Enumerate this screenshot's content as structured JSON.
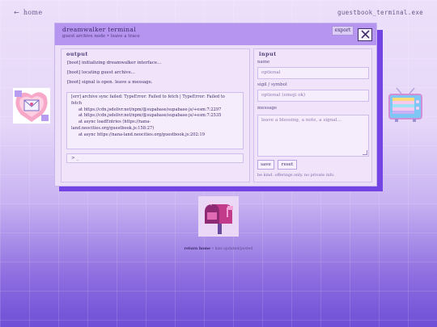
{
  "nav": {
    "home_arrow": "←",
    "home_label": "home",
    "site_name": "guestbook_terminal.exe"
  },
  "window": {
    "title": "dreamwalker terminal",
    "subtitle": "guest archive node • leave a trace",
    "export_label": "export",
    "close_icon": "close-icon"
  },
  "output": {
    "heading": "output",
    "lines": [
      "[boot] initializing dreamwalker interface...",
      "[boot] locating guest archive...",
      "[boot] signal is open. leave a message."
    ],
    "error_lines": [
      "[err] archive sync failed: TypeError: Failed to fetch | TypeError: Failed to",
      "fetch",
      "at https://cdn.jsdelivr.net/npm/@supabase/supabase-js/+esm:7:2297",
      "at https://cdn.jsdelivr.net/npm/@supabase/supabase-js/+esm:7:2535",
      "at async loadEntries (https://nana-",
      "land.neocities.org/guestbook.js:158:27)",
      "at async https://nana-land.neocities.org/guestbook.js:202:19"
    ],
    "prompt": "> _"
  },
  "input": {
    "heading": "input",
    "name_label": "name",
    "name_placeholder": "optional",
    "sigil_label": "sigil / symbol",
    "sigil_placeholder": "optional (emoji ok)",
    "message_label": "message",
    "message_placeholder": "leave a blessing, a note, a signal...",
    "save_label": "save",
    "reset_label": "reset",
    "note": "be kind. offerings only. no private info."
  },
  "stickers": {
    "left_icon": "envelope-heart-sticker",
    "right_icon": "retro-tv-sticker",
    "bottom_icon": "mailbox-sticker"
  },
  "footer": {
    "return_home": "return home",
    "sep": " • ",
    "tail": "kiss updated/posted"
  },
  "colors": {
    "accent": "#7443e4",
    "titlebar": "#b695f0",
    "panel": "#f1e3fa"
  }
}
